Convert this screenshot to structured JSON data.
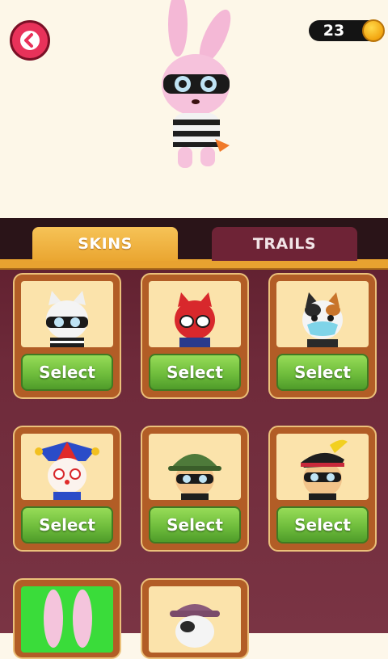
{
  "hud": {
    "coins": "23"
  },
  "tabs": [
    {
      "label": "SKINS",
      "active": true
    },
    {
      "label": "TRAILS",
      "active": false
    }
  ],
  "skins": [
    {
      "icon": "masked-cat-icon",
      "button": "Select"
    },
    {
      "icon": "spider-cat-icon",
      "button": "Select"
    },
    {
      "icon": "calico-cat-mask-icon",
      "button": "Select"
    },
    {
      "icon": "jester-character-icon",
      "button": "Select"
    },
    {
      "icon": "green-helmet-character-icon",
      "button": "Select"
    },
    {
      "icon": "pirate-hat-character-icon",
      "button": "Select"
    },
    {
      "icon": "bunny-ears-icon"
    },
    {
      "icon": "purple-hat-character-icon"
    }
  ],
  "colors": {
    "accent": "#e8a230",
    "select_green": "#6fbd3c",
    "back_red": "#e8325a"
  }
}
